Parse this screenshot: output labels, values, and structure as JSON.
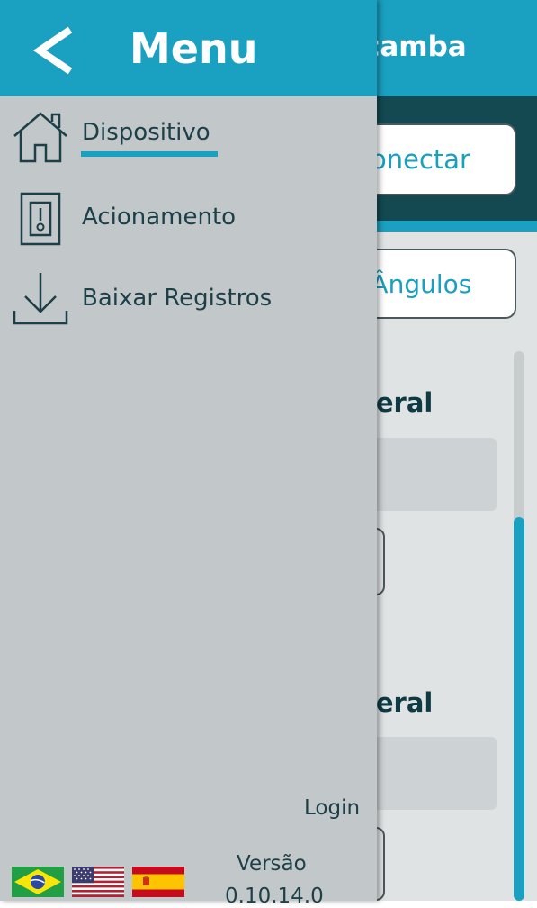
{
  "background": {
    "title": "çamba",
    "connect_button": "onectar",
    "angles_button": "r Ângulos",
    "section_label_1": "teral",
    "section_label_2": "teral"
  },
  "drawer": {
    "title": "Menu",
    "items": [
      {
        "label": "Dispositivo",
        "icon": "home-icon",
        "active": true
      },
      {
        "label": "Acionamento",
        "icon": "switch-icon",
        "active": false
      },
      {
        "label": "Baixar Registros",
        "icon": "download-icon",
        "active": false
      }
    ],
    "login": "Login",
    "version_label": "Versão",
    "version_value": "0.10.14.0",
    "languages": [
      "brazil-flag-icon",
      "usa-flag-icon",
      "spain-flag-icon"
    ]
  },
  "colors": {
    "accent": "#1aa0c0",
    "dark_band": "#144952",
    "drawer_bg": "#c2c7c9",
    "text_dark": "#1d3f47"
  }
}
